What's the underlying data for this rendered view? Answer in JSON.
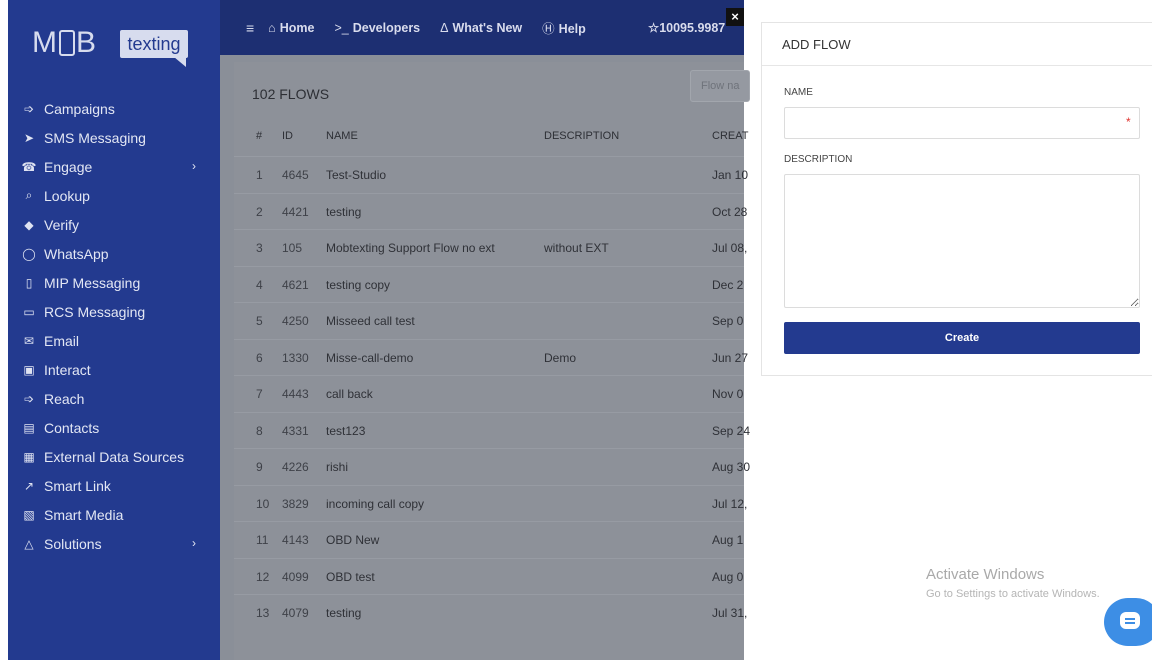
{
  "logo": {
    "brand_left": "M",
    "brand_right": "B",
    "tag": "texting"
  },
  "sidebar": {
    "items": [
      {
        "label": "Campaigns",
        "icon": "megaphone-icon",
        "glyph": "➩"
      },
      {
        "label": "SMS Messaging",
        "icon": "send-icon",
        "glyph": "➤"
      },
      {
        "label": "Engage",
        "icon": "phone-icon",
        "glyph": "☎",
        "chevron": "›"
      },
      {
        "label": "Lookup",
        "icon": "search-icon",
        "glyph": "⌕"
      },
      {
        "label": "Verify",
        "icon": "badge-icon",
        "glyph": "◆"
      },
      {
        "label": "WhatsApp",
        "icon": "whatsapp-icon",
        "glyph": "◯"
      },
      {
        "label": "MIP Messaging",
        "icon": "mobile-icon",
        "glyph": "▯"
      },
      {
        "label": "RCS Messaging",
        "icon": "chat-icon",
        "glyph": "▭"
      },
      {
        "label": "Email",
        "icon": "envelope-icon",
        "glyph": "✉"
      },
      {
        "label": "Interact",
        "icon": "ticket-icon",
        "glyph": "▣"
      },
      {
        "label": "Reach",
        "icon": "bullhorn-icon",
        "glyph": "➩"
      },
      {
        "label": "Contacts",
        "icon": "contacts-icon",
        "glyph": "▤"
      },
      {
        "label": "External Data Sources",
        "icon": "database-icon",
        "glyph": "▦"
      },
      {
        "label": "Smart Link",
        "icon": "link-icon",
        "glyph": "↗"
      },
      {
        "label": "Smart Media",
        "icon": "image-icon",
        "glyph": "▧"
      },
      {
        "label": "Solutions",
        "icon": "warning-icon",
        "glyph": "△",
        "chevron": "›"
      }
    ]
  },
  "topbar": {
    "menu_glyph": "≡",
    "home_glyph": "⌂",
    "home": "Home",
    "dev_glyph": ">_",
    "developers": "Developers",
    "whats_glyph": "Δ",
    "whats_new": "What's New",
    "help_glyph": "Ⓗ",
    "help": "Help",
    "credits": "☆10095.9987",
    "close": "×"
  },
  "flows": {
    "title": "102 FLOWS",
    "filter_placeholder": "Flow na",
    "columns": {
      "num": "#",
      "id": "ID",
      "name": "NAME",
      "description": "DESCRIPTION",
      "created": "CREAT"
    },
    "rows": [
      {
        "num": "1",
        "id": "4645",
        "name": "Test-Studio",
        "description": "",
        "created": "Jan 10"
      },
      {
        "num": "2",
        "id": "4421",
        "name": "testing",
        "description": "",
        "created": "Oct 28"
      },
      {
        "num": "3",
        "id": "105",
        "name": "Mobtexting Support Flow no ext",
        "description": "without EXT",
        "created": "Jul 08,"
      },
      {
        "num": "4",
        "id": "4621",
        "name": "testing copy",
        "description": "",
        "created": "Dec 2"
      },
      {
        "num": "5",
        "id": "4250",
        "name": "Misseed call test",
        "description": "",
        "created": "Sep 0"
      },
      {
        "num": "6",
        "id": "1330",
        "name": "Misse-call-demo",
        "description": "Demo",
        "created": "Jun 27"
      },
      {
        "num": "7",
        "id": "4443",
        "name": "call back",
        "description": "",
        "created": "Nov 0"
      },
      {
        "num": "8",
        "id": "4331",
        "name": "test123",
        "description": "",
        "created": "Sep 24"
      },
      {
        "num": "9",
        "id": "4226",
        "name": "rishi",
        "description": "",
        "created": "Aug 30"
      },
      {
        "num": "10",
        "id": "3829",
        "name": "incoming call copy",
        "description": "",
        "created": "Jul 12,"
      },
      {
        "num": "11",
        "id": "4143",
        "name": "OBD New",
        "description": "",
        "created": "Aug 1"
      },
      {
        "num": "12",
        "id": "4099",
        "name": "OBD test",
        "description": "",
        "created": "Aug 0"
      },
      {
        "num": "13",
        "id": "4079",
        "name": "testing",
        "description": "",
        "created": "Jul 31,"
      }
    ]
  },
  "panel": {
    "title": "ADD FLOW",
    "name_label": "NAME",
    "name_value": "",
    "required_mark": "*",
    "description_label": "DESCRIPTION",
    "description_value": "",
    "create_label": "Create"
  },
  "watermark": {
    "line1": "Activate Windows",
    "line2": "Go to Settings to activate Windows."
  },
  "colors": {
    "brand": "#233a8f",
    "topbar": "#1d2f72",
    "overlay": "#8a8f98",
    "required": "#e0342f",
    "chat": "#3d8ee5"
  }
}
